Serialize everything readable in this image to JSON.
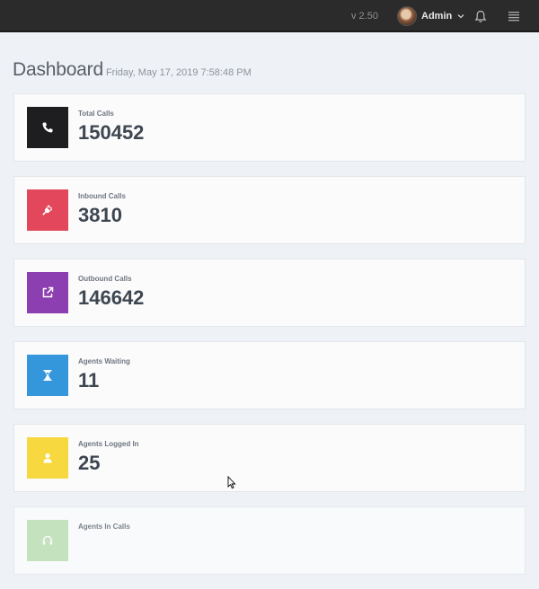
{
  "header": {
    "version": "v 2.50",
    "user_name": "Admin",
    "icons": [
      "avatar",
      "chevron-down-icon",
      "bell-icon",
      "menu-icon"
    ]
  },
  "page": {
    "title": "Dashboard",
    "datetime": "Friday, May 17, 2019 7:58:48 PM"
  },
  "cards": [
    {
      "label": "Total Calls",
      "value": "150452",
      "color": "#1e1e20",
      "icon": "phone-icon"
    },
    {
      "label": "Inbound Calls",
      "value": "3810",
      "color": "#e2475b",
      "icon": "plug-icon"
    },
    {
      "label": "Outbound Calls",
      "value": "146642",
      "color": "#8c3fb0",
      "icon": "external-link-icon"
    },
    {
      "label": "Agents Waiting",
      "value": "11",
      "color": "#3497dc",
      "icon": "hourglass-icon"
    },
    {
      "label": "Agents Logged In",
      "value": "25",
      "color": "#f7d83e",
      "icon": "user-icon"
    },
    {
      "label": "Agents In Calls",
      "value": "",
      "color": "#7cc26a",
      "icon": "headset-icon"
    }
  ]
}
